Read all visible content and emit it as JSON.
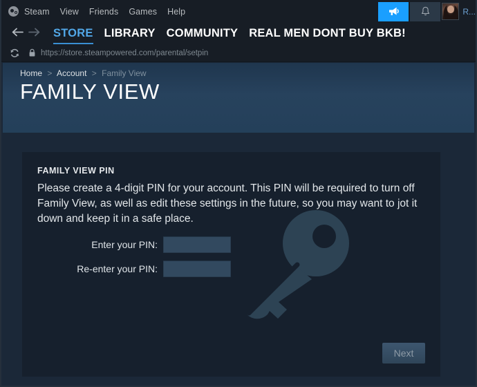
{
  "client": {
    "logo_icon": "steam-logo-icon",
    "menu": [
      {
        "label": "Steam"
      },
      {
        "label": "View"
      },
      {
        "label": "Friends"
      },
      {
        "label": "Games"
      },
      {
        "label": "Help"
      }
    ],
    "broadcast_icon": "megaphone-icon",
    "notifications_icon": "bell-icon",
    "avatar_icon": "user-avatar",
    "username": "R..."
  },
  "nav": {
    "back_icon": "arrow-left-icon",
    "forward_icon": "arrow-right-icon",
    "tabs": [
      {
        "label": "STORE",
        "active": true
      },
      {
        "label": "LIBRARY",
        "active": false
      },
      {
        "label": "COMMUNITY",
        "active": false
      },
      {
        "label": "REAL MEN DONT BUY BKB!",
        "active": false
      }
    ]
  },
  "urlbar": {
    "reload_icon": "reload-icon",
    "lock_icon": "lock-icon",
    "url": "https://store.steampowered.com/parental/setpin"
  },
  "header": {
    "breadcrumb": {
      "home": "Home",
      "separator": ">",
      "account": "Account",
      "current": "Family View"
    },
    "title": "FAMILY VIEW"
  },
  "panel": {
    "section_label": "FAMILY VIEW PIN",
    "intro": "Please create a 4-digit PIN for your account. This PIN will be required to turn off Family View, as well as edit these settings in the future, so you may want to jot it down and keep it in a safe place.",
    "watermark_icon": "key-icon",
    "fields": [
      {
        "label": "Enter your PIN:",
        "value": "",
        "placeholder": "",
        "name": "pin-input"
      },
      {
        "label": "Re-enter your PIN:",
        "value": "",
        "placeholder": "",
        "name": "pin-confirm-input"
      }
    ],
    "next_label": "Next"
  },
  "colors": {
    "accent_blue": "#1a9fff",
    "tab_active": "#52a8e8",
    "header_band": "#27425d",
    "page_bg": "#1b2838",
    "panel_bg": "#16202d",
    "input_bg": "#32495f"
  }
}
